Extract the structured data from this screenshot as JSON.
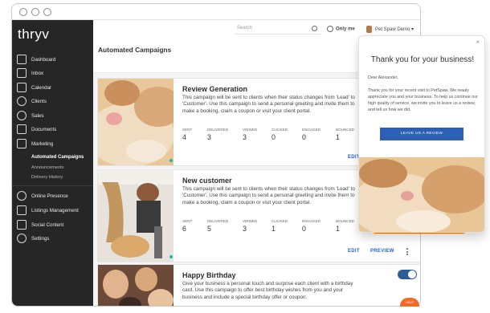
{
  "sidebar": {
    "logo": "thryv",
    "items": [
      {
        "label": "Dashboard"
      },
      {
        "label": "Inbox"
      },
      {
        "label": "Calendar"
      },
      {
        "label": "Clients"
      },
      {
        "label": "Sales"
      },
      {
        "label": "Documents"
      },
      {
        "label": "Marketing"
      },
      {
        "label": "Online Presence"
      },
      {
        "label": "Listings Management"
      },
      {
        "label": "Social Content"
      },
      {
        "label": "Settings"
      }
    ],
    "marketing_sub": [
      {
        "label": "Automated Campaigns",
        "active": true
      },
      {
        "label": "Announcements",
        "active": false
      },
      {
        "label": "Delivery History",
        "active": false
      }
    ]
  },
  "header": {
    "search_placeholder": "Search",
    "visibility": "Only me",
    "account": "Pet Spaw Demo ▾"
  },
  "page": {
    "title": "Automated Campaigns"
  },
  "campaigns": [
    {
      "title": "Review Generation",
      "description": "This campaign will be sent to clients when their status changes from 'Lead' to 'Customer'. Use this campaign to send a personal greeting and invite them to make a booking, claim a coupon or visit your client portal.",
      "stats": [
        {
          "label": "SENT",
          "value": "4"
        },
        {
          "label": "DELIVERED",
          "value": "3"
        },
        {
          "label": "VIEWED",
          "value": "3"
        },
        {
          "label": "CLICKED",
          "value": "0"
        },
        {
          "label": "ENGAGED",
          "value": "0"
        },
        {
          "label": "BOUNCED",
          "value": "1"
        }
      ],
      "edit": "EDIT"
    },
    {
      "title": "New customer",
      "description": "This campaign will be sent to clients when their status changes from 'Lead' to 'Customer'. Use this campaign to send a personal greeting and invite them to make a booking, claim a coupon or visit your client portal.",
      "stats": [
        {
          "label": "SENT",
          "value": "6"
        },
        {
          "label": "DELIVERED",
          "value": "5"
        },
        {
          "label": "VIEWED",
          "value": "3"
        },
        {
          "label": "CLICKED",
          "value": "1"
        },
        {
          "label": "ENGAGED",
          "value": "0"
        },
        {
          "label": "BOUNCED",
          "value": "1"
        }
      ],
      "extra_value": "0",
      "edit": "EDIT",
      "preview": "PREVIEW"
    },
    {
      "title": "Happy Birthday",
      "description": "Give your business a personal touch and surprise each client with a birthday card. Use this campaign to offer best birthday wishes from you and your business and include a special birthday offer or coupon."
    }
  ],
  "popup": {
    "close": "×",
    "title": "Thank you for your business!",
    "greeting": "Dear Alexander,",
    "body": "Thank you for your recent visit to PetSpaw. We reaaly appreciate you and your business. To help us continue our high quality of service, we invite you to leave us a review, and tell us how we did.",
    "button": "LEAVE US A REVIEW"
  },
  "corner_tag": "HELP",
  "colors": {
    "sidebar_bg": "#262626",
    "link": "#1d63c6",
    "toggle": "#2f5e96",
    "popup_button": "#2c5fb8",
    "accent_orange": "#ef7b1e",
    "status_dot": "#22b7a6"
  }
}
